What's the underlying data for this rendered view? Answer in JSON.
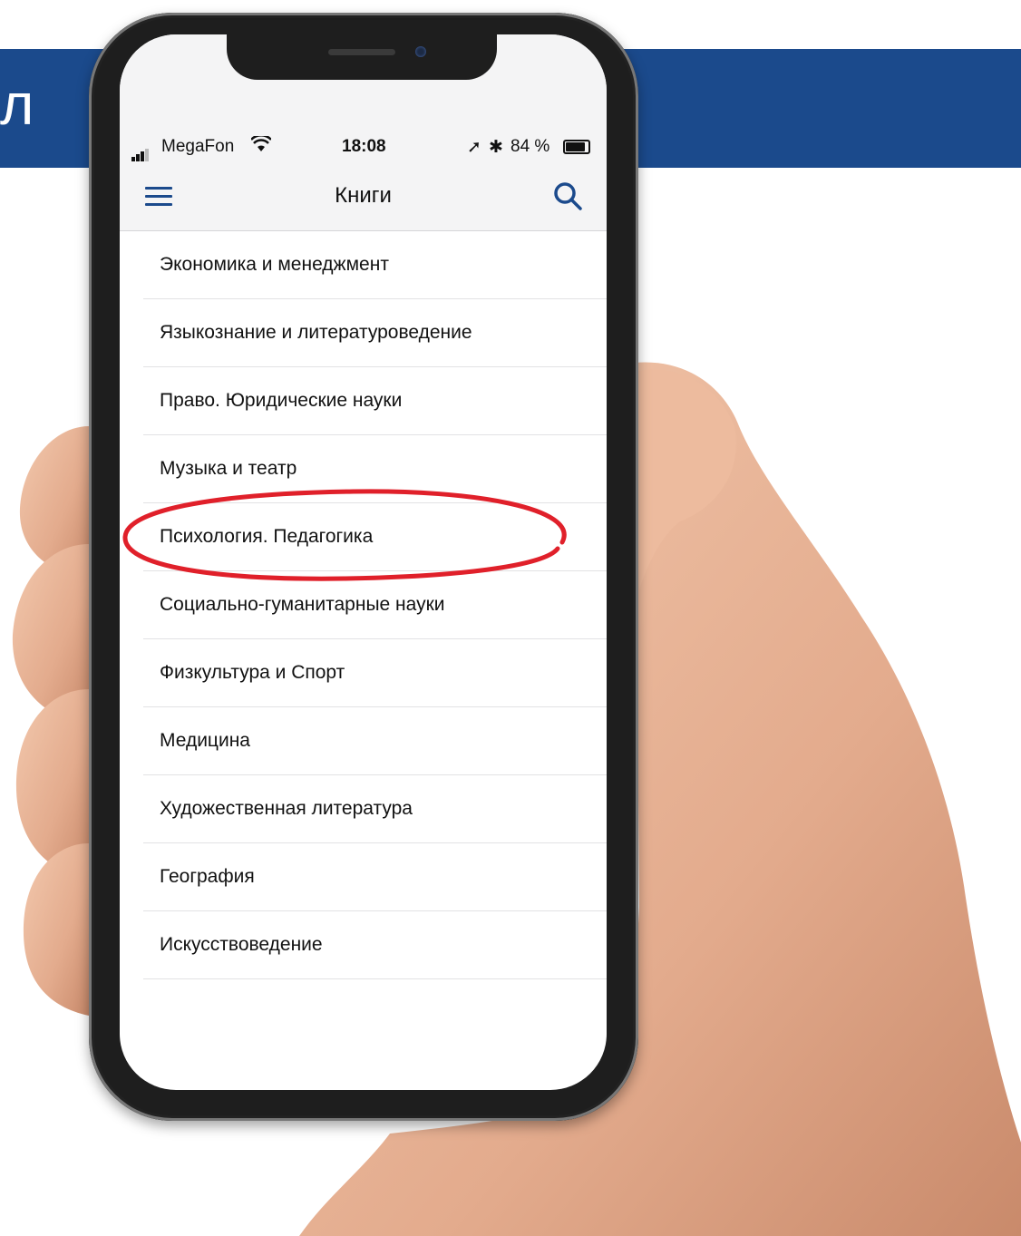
{
  "banner": {
    "text": "л",
    "color": "#1b4a8c"
  },
  "status_bar": {
    "carrier": "MegaFon",
    "time": "18:08",
    "battery": "84 %",
    "icons": [
      "signal-icon",
      "wifi-icon",
      "location-icon",
      "bluetooth-icon",
      "battery-icon"
    ]
  },
  "nav": {
    "title": "Книги",
    "menu_icon": "hamburger-menu-icon",
    "search_icon": "search-icon",
    "accent": "#1b4a8c"
  },
  "categories": [
    {
      "label": "Экономика и менеджмент"
    },
    {
      "label": "Языкознание и литературоведение"
    },
    {
      "label": "Право. Юридические науки"
    },
    {
      "label": "Музыка и театр"
    },
    {
      "label": "Психология. Педагогика",
      "highlighted": true
    },
    {
      "label": "Социально-гуманитарные науки"
    },
    {
      "label": "Физкультура и Спорт"
    },
    {
      "label": "Медицина"
    },
    {
      "label": "Художественная литература"
    },
    {
      "label": "География"
    },
    {
      "label": "Искусствоведение"
    }
  ],
  "highlight_color": "#e0202a"
}
